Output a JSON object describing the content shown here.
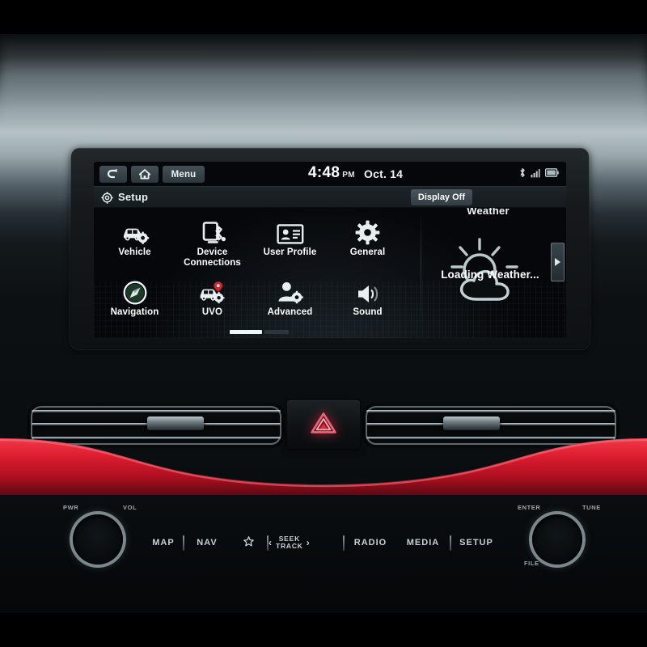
{
  "device": {
    "name": "car-infotainment-head-unit",
    "screen_state": "Setup menu page 1"
  },
  "statusbar": {
    "back_label": "↰",
    "back_icon": "back-arrow-icon",
    "home_icon": "home-icon",
    "menu_label": "Menu",
    "time": "4:48",
    "ampm": "PM",
    "date": "Oct. 14",
    "icons": [
      "bluetooth-icon",
      "signal-bars-icon",
      "battery-icon"
    ]
  },
  "titlebar": {
    "icon": "gear-icon",
    "title": "Setup",
    "display_off_label": "Display Off"
  },
  "menu": {
    "items": [
      {
        "label": "Vehicle",
        "icon": "car-gear-icon"
      },
      {
        "label": "Device Connections",
        "icon": "phone-bluetooth-icon"
      },
      {
        "label": "User Profile",
        "icon": "id-card-icon"
      },
      {
        "label": "General",
        "icon": "gear-icon"
      },
      {
        "label": "Navigation",
        "icon": "compass-icon"
      },
      {
        "label": "UVO",
        "icon": "car-pin-icon"
      },
      {
        "label": "Advanced",
        "icon": "person-gear-icon"
      },
      {
        "label": "Sound",
        "icon": "speaker-icon"
      }
    ],
    "page_indicator": {
      "current": 1,
      "total": 2
    }
  },
  "weather": {
    "title": "Weather",
    "status": "Loading Weather...",
    "icon": "sun-behind-cloud-icon",
    "next_arrow": "chevron-right-icon"
  },
  "hazard": {
    "label": "hazard-warning",
    "icon": "warning-triangle-icon",
    "color": "#e8283a"
  },
  "climate": {
    "left_vent": "air-vent-left",
    "right_vent": "air-vent-right"
  },
  "console": {
    "left_knob": {
      "name": "power-volume-knob",
      "labels": [
        "PWR",
        "VOL"
      ]
    },
    "right_knob": {
      "name": "tune-file-knob",
      "labels": [
        "ENTER",
        "TUNE",
        "FILE"
      ]
    },
    "buttons": [
      {
        "label": "MAP",
        "type": "text"
      },
      {
        "label": "|",
        "type": "separator"
      },
      {
        "label": "NAV",
        "type": "text"
      },
      {
        "label": "★",
        "type": "icon",
        "icon": "star-favorite-icon"
      },
      {
        "label": "|",
        "type": "separator"
      },
      {
        "label": "SEEK",
        "sub": "TRACK",
        "type": "seek"
      },
      {
        "label": "|",
        "type": "separator"
      },
      {
        "label": "RADIO",
        "type": "text"
      },
      {
        "label": "MEDIA",
        "type": "text"
      },
      {
        "label": "|",
        "type": "separator"
      },
      {
        "label": "SETUP",
        "type": "text"
      }
    ]
  },
  "colors": {
    "accent_red": "#d01628",
    "screen_bg": "#05070a",
    "text": "#ffffff",
    "button_face": "#3a464c"
  }
}
